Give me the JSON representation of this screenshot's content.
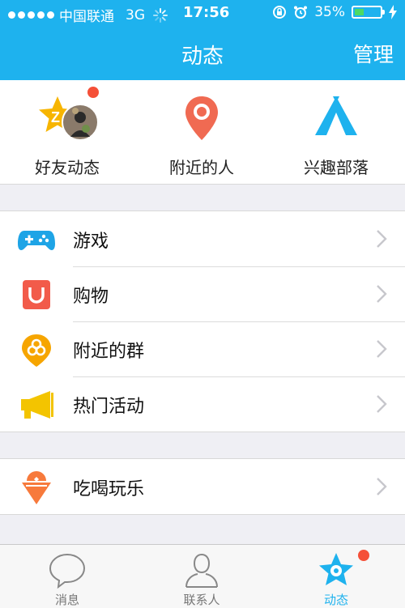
{
  "status_bar": {
    "carrier": "中国联通",
    "network": "3G",
    "time": "17:56",
    "battery": "35%",
    "battery_level": 0.35
  },
  "nav": {
    "title": "动态",
    "manage_label": "管理"
  },
  "quick_items": [
    {
      "label": "好友动态",
      "icon": "friends-feed-icon"
    },
    {
      "label": "附近的人",
      "icon": "location-pin-icon"
    },
    {
      "label": "兴趣部落",
      "icon": "tent-icon"
    }
  ],
  "list_group_1": [
    {
      "label": "游戏",
      "icon": "gamepad-icon"
    },
    {
      "label": "购物",
      "icon": "shopping-icon"
    },
    {
      "label": "附近的群",
      "icon": "nearby-groups-icon"
    },
    {
      "label": "热门活动",
      "icon": "megaphone-icon"
    }
  ],
  "list_group_2": [
    {
      "label": "吃喝玩乐",
      "icon": "ice-cream-icon"
    }
  ],
  "tabs": [
    {
      "label": "消息",
      "icon": "chat-bubble-icon"
    },
    {
      "label": "联系人",
      "icon": "contact-person-icon"
    },
    {
      "label": "动态",
      "icon": "star-icon",
      "active": true
    }
  ],
  "colors": {
    "header": "#1eb2ee",
    "badge": "#f55038",
    "active_tab": "#1eb2ee"
  }
}
